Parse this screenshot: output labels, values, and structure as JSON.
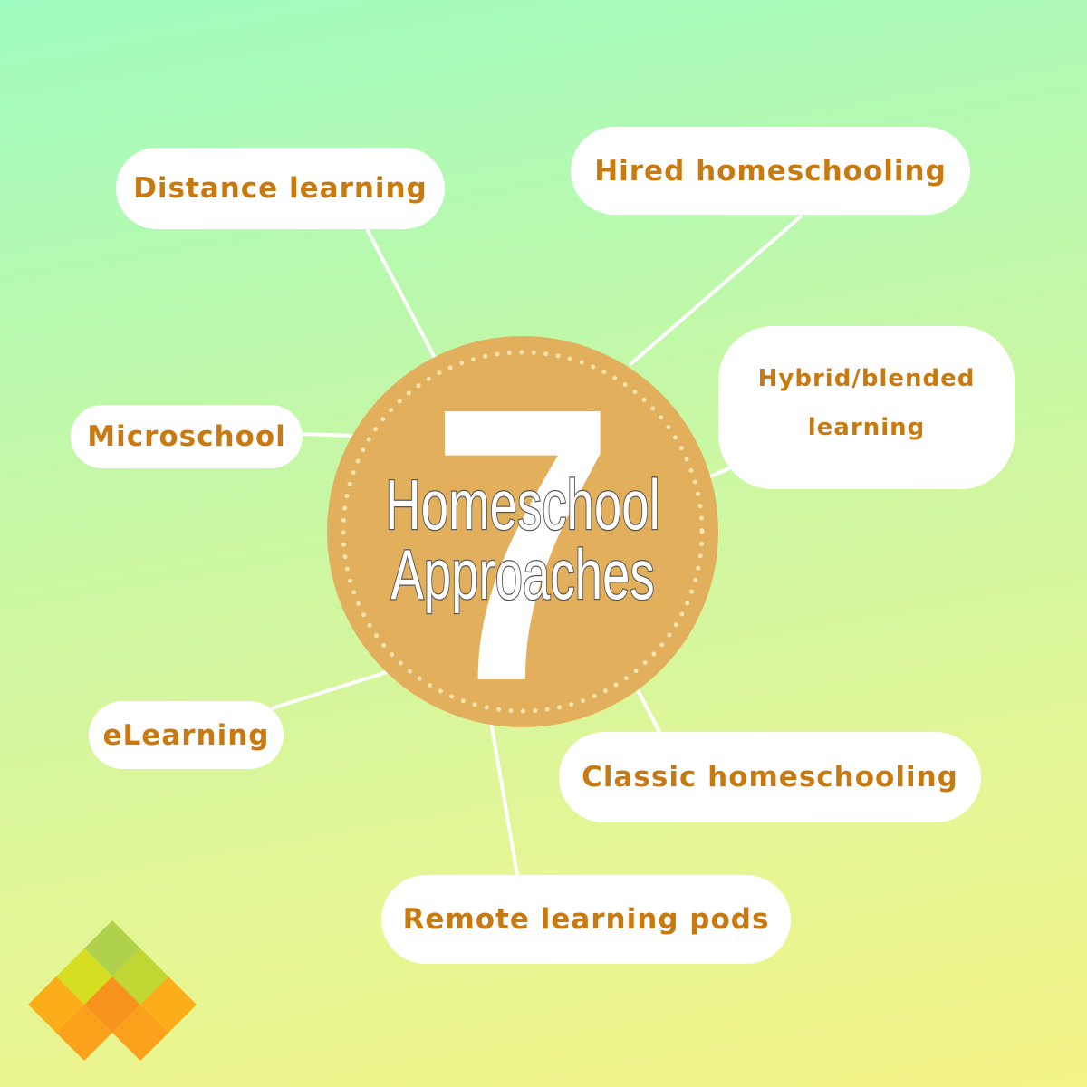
{
  "center": {
    "number": "7",
    "line1": "Homeschool",
    "line2": "Approaches"
  },
  "approaches": [
    {
      "label": "Distance learning"
    },
    {
      "label": "Hired homeschooling"
    },
    {
      "label": "Hybrid/blended learning",
      "line1": "Hybrid/blended",
      "line2": "learning"
    },
    {
      "label": "Microschool"
    },
    {
      "label": "eLearning"
    },
    {
      "label": "Classic homeschooling"
    },
    {
      "label": "Remote learning pods"
    }
  ],
  "colors": {
    "label_text": "#c87a10",
    "circle": "#e2b05d",
    "dots": "#f6e3b0",
    "connector": "#ffffff"
  },
  "logo": {
    "colors": [
      "#afd14c",
      "#d6de22",
      "#c0d733",
      "#fcae1a",
      "#f7941e",
      "#faa01b"
    ]
  }
}
